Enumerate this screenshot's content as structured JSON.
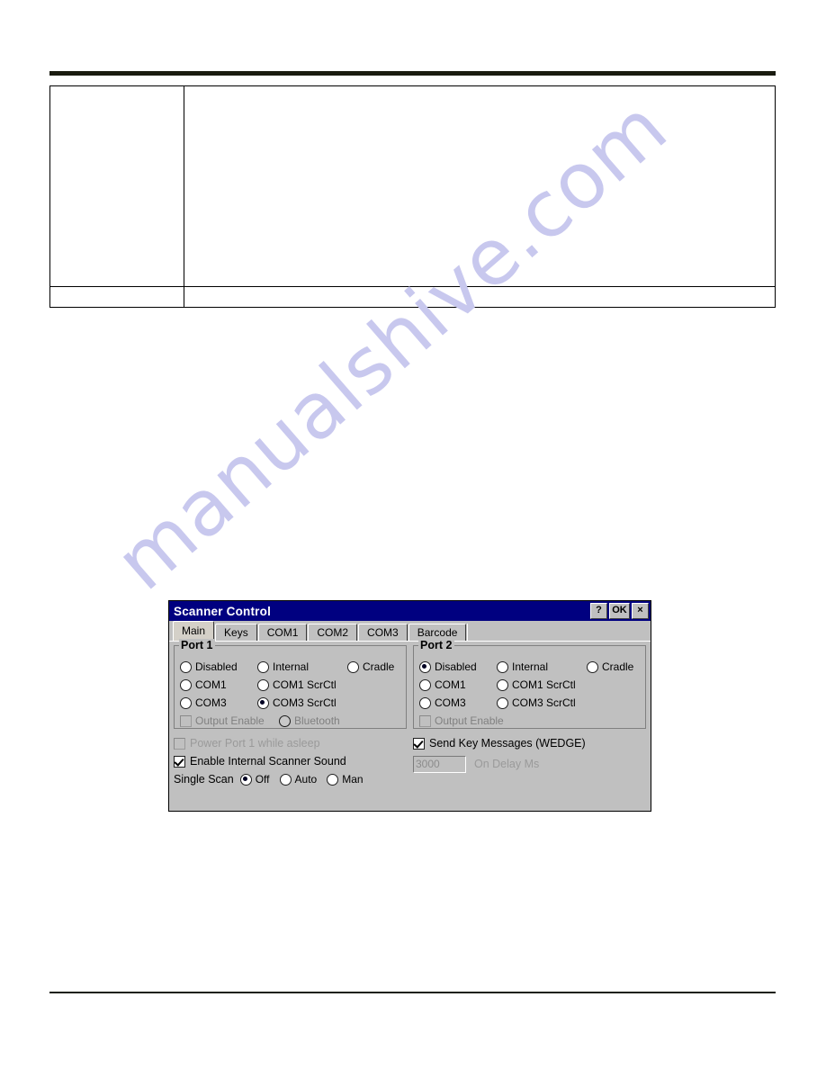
{
  "document": {
    "watermark": "manualshive.com",
    "table": {
      "rows": [
        {
          "cells": [
            "",
            ""
          ],
          "kind": "tall"
        },
        {
          "cells": [
            "",
            ""
          ],
          "kind": "short"
        }
      ]
    }
  },
  "dialog": {
    "title": "Scanner Control",
    "title_buttons": [
      {
        "name": "help",
        "label": "?"
      },
      {
        "name": "ok",
        "label": "OK"
      },
      {
        "name": "close",
        "label": "×"
      }
    ],
    "tabs": [
      {
        "label": "Main",
        "active": true
      },
      {
        "label": "Keys",
        "active": false
      },
      {
        "label": "COM1",
        "active": false
      },
      {
        "label": "COM2",
        "active": false
      },
      {
        "label": "COM3",
        "active": false
      },
      {
        "label": "Barcode",
        "active": false
      }
    ],
    "port1": {
      "legend": "Port 1",
      "options": {
        "disabled": "Disabled",
        "internal": "Internal",
        "cradle": "Cradle",
        "com1": "COM1",
        "com1_scrctl": "COM1 ScrCtl",
        "com3": "COM3",
        "com3_scrctl": "COM3 ScrCtl",
        "output_enable": "Output Enable",
        "bluetooth": "Bluetooth"
      },
      "selected": "COM3 ScrCtl",
      "output_enable_checked": false,
      "output_enable_disabled": true,
      "bluetooth_disabled": true
    },
    "port2": {
      "legend": "Port 2",
      "options": {
        "disabled": "Disabled",
        "internal": "Internal",
        "cradle": "Cradle",
        "com1": "COM1",
        "com1_scrctl": "COM1 ScrCtl",
        "com3": "COM3",
        "com3_scrctl": "COM3 ScrCtl",
        "output_enable": "Output Enable"
      },
      "selected": "Disabled",
      "output_enable_checked": false,
      "output_enable_disabled": true
    },
    "left_bottom": {
      "power_port_label": "Power Port 1 while asleep",
      "power_port_checked": false,
      "power_port_disabled": true,
      "sound_label": "Enable Internal Scanner Sound",
      "sound_checked": true,
      "single_scan_label": "Single Scan",
      "single_scan_options": [
        "Off",
        "Auto",
        "Man"
      ],
      "single_scan_selected": "Off"
    },
    "right_bottom": {
      "wedge_label": "Send Key Messages (WEDGE)",
      "wedge_checked": true,
      "on_delay_value": "3000",
      "on_delay_label": "On Delay Ms",
      "on_delay_disabled": true
    },
    "colors": {
      "titlebar": "#000080",
      "titlebar_text": "#ffffff",
      "face": "#c0c0c0",
      "disabled_text": "#9a9a9a",
      "watermark": "#c8c8ee"
    }
  }
}
